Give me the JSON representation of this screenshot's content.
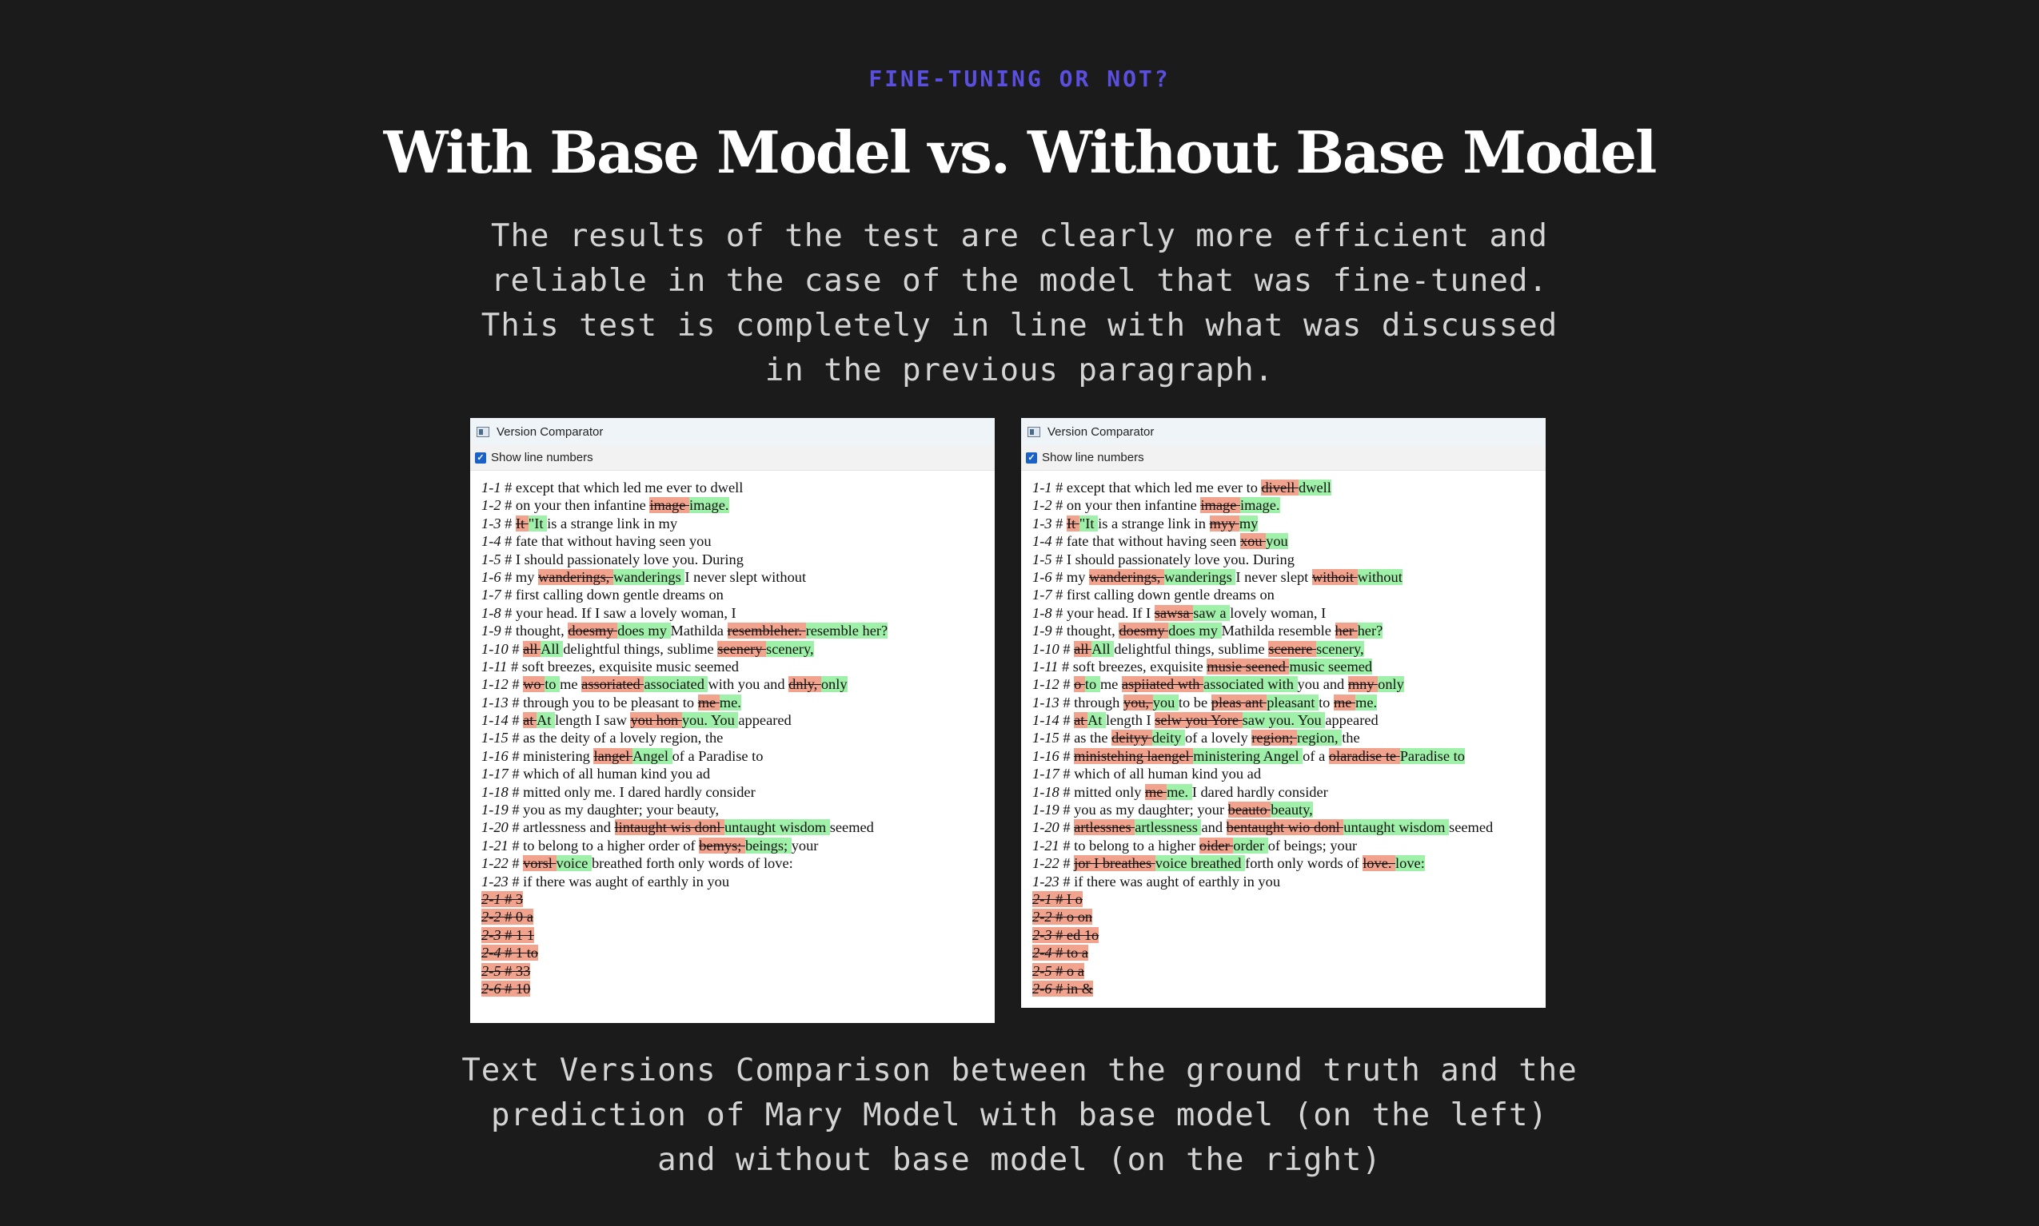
{
  "header": {
    "eyebrow": "FINE-TUNING OR NOT?",
    "title": "With Base Model vs. Without Base Model",
    "intro": "The results of the test are clearly more efficient and reliable in the case of the model that was fine-tuned. This test is completely in line with what was discussed in the previous paragraph."
  },
  "colors": {
    "background": "#1b1b1b",
    "accent": "#5b4fe0",
    "deleted_highlight": "#f2a38d",
    "inserted_highlight": "#9ff0a8"
  },
  "left_window": {
    "title": "Version Comparator",
    "show_line_numbers_label": "Show line numbers",
    "show_line_numbers_checked": true,
    "lines": [
      {
        "n": "1-1",
        "segs": [
          [
            "t",
            "except that which led me ever to dwell"
          ]
        ]
      },
      {
        "n": "1-2",
        "segs": [
          [
            "t",
            "on your then infantine "
          ],
          [
            "d",
            "image "
          ],
          [
            "i",
            "image."
          ]
        ]
      },
      {
        "n": "1-3",
        "segs": [
          [
            "d",
            "It "
          ],
          [
            "i",
            "\"It "
          ],
          [
            "t",
            "is a strange link in my"
          ]
        ]
      },
      {
        "n": "1-4",
        "segs": [
          [
            "t",
            "fate that without having seen you"
          ]
        ]
      },
      {
        "n": "1-5",
        "segs": [
          [
            "t",
            "I should passionately love you. During"
          ]
        ]
      },
      {
        "n": "1-6",
        "segs": [
          [
            "t",
            "my "
          ],
          [
            "d",
            "wanderings, "
          ],
          [
            "i",
            "wanderings "
          ],
          [
            "t",
            "I never slept without"
          ]
        ]
      },
      {
        "n": "1-7",
        "segs": [
          [
            "t",
            "first calling down gentle dreams on"
          ]
        ]
      },
      {
        "n": "1-8",
        "segs": [
          [
            "t",
            "your head. If I saw a lovely woman, I"
          ]
        ]
      },
      {
        "n": "1-9",
        "segs": [
          [
            "t",
            "thought, "
          ],
          [
            "d",
            "doesmy "
          ],
          [
            "i",
            "does my "
          ],
          [
            "t",
            "Mathilda "
          ],
          [
            "d",
            "resembleher. "
          ],
          [
            "i",
            "resemble her?"
          ]
        ]
      },
      {
        "n": "1-10",
        "segs": [
          [
            "d",
            "all "
          ],
          [
            "i",
            "All "
          ],
          [
            "t",
            "delightful things, sublime "
          ],
          [
            "d",
            "seenery "
          ],
          [
            "i",
            "scenery,"
          ]
        ]
      },
      {
        "n": "1-11",
        "segs": [
          [
            "t",
            "soft breezes, exquisite music seemed"
          ]
        ]
      },
      {
        "n": "1-12",
        "segs": [
          [
            "d",
            "wo "
          ],
          [
            "i",
            "to "
          ],
          [
            "t",
            "me "
          ],
          [
            "d",
            "assoriated "
          ],
          [
            "i",
            "associated "
          ],
          [
            "t",
            "with you and "
          ],
          [
            "d",
            "dnly, "
          ],
          [
            "i",
            "only"
          ]
        ]
      },
      {
        "n": "1-13",
        "segs": [
          [
            "t",
            "through you to be pleasant to "
          ],
          [
            "d",
            "me "
          ],
          [
            "i",
            "me."
          ]
        ]
      },
      {
        "n": "1-14",
        "segs": [
          [
            "d",
            "at "
          ],
          [
            "i",
            "At "
          ],
          [
            "t",
            "length I saw "
          ],
          [
            "d",
            "you hon "
          ],
          [
            "i",
            "you. You "
          ],
          [
            "t",
            "appeared"
          ]
        ]
      },
      {
        "n": "1-15",
        "segs": [
          [
            "t",
            "as the deity of a lovely region, the"
          ]
        ]
      },
      {
        "n": "1-16",
        "segs": [
          [
            "t",
            "ministering "
          ],
          [
            "d",
            "langel "
          ],
          [
            "i",
            "Angel "
          ],
          [
            "t",
            "of a Paradise to"
          ]
        ]
      },
      {
        "n": "1-17",
        "segs": [
          [
            "t",
            "which of all human kind you ad"
          ]
        ]
      },
      {
        "n": "1-18",
        "segs": [
          [
            "t",
            "mitted only me. I dared hardly consider"
          ]
        ]
      },
      {
        "n": "1-19",
        "segs": [
          [
            "t",
            "you as my daughter; your beauty,"
          ]
        ]
      },
      {
        "n": "1-20",
        "segs": [
          [
            "t",
            "artlessness and "
          ],
          [
            "d",
            "lintaught wis donl "
          ],
          [
            "i",
            "untaught wisdom "
          ],
          [
            "t",
            "seemed"
          ]
        ]
      },
      {
        "n": "1-21",
        "segs": [
          [
            "t",
            "to belong to a higher order of "
          ],
          [
            "d",
            "bemys; "
          ],
          [
            "i",
            "beings; "
          ],
          [
            "t",
            "your"
          ]
        ]
      },
      {
        "n": "1-22",
        "segs": [
          [
            "d",
            "vorsl "
          ],
          [
            "i",
            "voice "
          ],
          [
            "t",
            "breathed forth only words of love:"
          ]
        ]
      },
      {
        "n": "1-23",
        "segs": [
          [
            "t",
            "if there was aught of earthly in you"
          ]
        ]
      },
      {
        "n": "2-1",
        "del": true,
        "segs": [
          [
            "d",
            "3"
          ]
        ]
      },
      {
        "n": "2-2",
        "del": true,
        "segs": [
          [
            "d",
            "0 a"
          ]
        ]
      },
      {
        "n": "2-3",
        "del": true,
        "segs": [
          [
            "d",
            "1 1"
          ]
        ]
      },
      {
        "n": "2-4",
        "del": true,
        "segs": [
          [
            "d",
            "1 to"
          ]
        ]
      },
      {
        "n": "2-5",
        "del": true,
        "segs": [
          [
            "d",
            "33"
          ]
        ]
      },
      {
        "n": "2-6",
        "del": true,
        "segs": [
          [
            "d",
            "10"
          ]
        ]
      }
    ]
  },
  "right_window": {
    "title": "Version Comparator",
    "show_line_numbers_label": "Show line numbers",
    "show_line_numbers_checked": true,
    "lines": [
      {
        "n": "1-1",
        "segs": [
          [
            "t",
            "except that which led me ever to "
          ],
          [
            "d",
            "divell "
          ],
          [
            "i",
            "dwell"
          ]
        ]
      },
      {
        "n": "1-2",
        "segs": [
          [
            "t",
            "on your then infantine "
          ],
          [
            "d",
            "image "
          ],
          [
            "i",
            "image."
          ]
        ]
      },
      {
        "n": "1-3",
        "segs": [
          [
            "d",
            "It "
          ],
          [
            "i",
            "\"It "
          ],
          [
            "t",
            "is a strange link in "
          ],
          [
            "d",
            "myy "
          ],
          [
            "i",
            "my"
          ]
        ]
      },
      {
        "n": "1-4",
        "segs": [
          [
            "t",
            "fate that without having seen "
          ],
          [
            "d",
            "xou "
          ],
          [
            "i",
            "you"
          ]
        ]
      },
      {
        "n": "1-5",
        "segs": [
          [
            "t",
            "I should passionately love you. During"
          ]
        ]
      },
      {
        "n": "1-6",
        "segs": [
          [
            "t",
            "my "
          ],
          [
            "d",
            "wanderings, "
          ],
          [
            "i",
            "wanderings "
          ],
          [
            "t",
            "I never slept "
          ],
          [
            "d",
            "withoit "
          ],
          [
            "i",
            "without"
          ]
        ]
      },
      {
        "n": "1-7",
        "segs": [
          [
            "t",
            "first calling down gentle dreams on"
          ]
        ]
      },
      {
        "n": "1-8",
        "segs": [
          [
            "t",
            "your head. If I "
          ],
          [
            "d",
            "sawsa "
          ],
          [
            "i",
            "saw a "
          ],
          [
            "t",
            "lovely woman, I"
          ]
        ]
      },
      {
        "n": "1-9",
        "segs": [
          [
            "t",
            "thought, "
          ],
          [
            "d",
            "doesmy "
          ],
          [
            "i",
            "does my "
          ],
          [
            "t",
            "Mathilda resemble "
          ],
          [
            "d",
            "her "
          ],
          [
            "i",
            "her?"
          ]
        ]
      },
      {
        "n": "1-10",
        "segs": [
          [
            "d",
            "all "
          ],
          [
            "i",
            "All "
          ],
          [
            "t",
            "delightful things, sublime "
          ],
          [
            "d",
            "scenere "
          ],
          [
            "i",
            "scenery,"
          ]
        ]
      },
      {
        "n": "1-11",
        "segs": [
          [
            "t",
            "soft breezes, exquisite "
          ],
          [
            "d",
            "musie seened "
          ],
          [
            "i",
            "music seemed"
          ]
        ]
      },
      {
        "n": "1-12",
        "segs": [
          [
            "d",
            "o "
          ],
          [
            "i",
            "to "
          ],
          [
            "t",
            "me "
          ],
          [
            "d",
            "aspiiated wth "
          ],
          [
            "i",
            "associated with "
          ],
          [
            "t",
            "you and "
          ],
          [
            "d",
            "mny "
          ],
          [
            "i",
            "only"
          ]
        ]
      },
      {
        "n": "1-13",
        "segs": [
          [
            "t",
            "through "
          ],
          [
            "d",
            "you, "
          ],
          [
            "i",
            "you "
          ],
          [
            "t",
            "to be "
          ],
          [
            "d",
            "pleas ant "
          ],
          [
            "i",
            "pleasant "
          ],
          [
            "t",
            "to "
          ],
          [
            "d",
            "me "
          ],
          [
            "i",
            "me."
          ]
        ]
      },
      {
        "n": "1-14",
        "segs": [
          [
            "d",
            "at "
          ],
          [
            "i",
            "At "
          ],
          [
            "t",
            "length I "
          ],
          [
            "d",
            "selw you Yore "
          ],
          [
            "i",
            "saw you. You "
          ],
          [
            "t",
            "appeared"
          ]
        ]
      },
      {
        "n": "1-15",
        "segs": [
          [
            "t",
            "as the "
          ],
          [
            "d",
            "deityy "
          ],
          [
            "i",
            "deity "
          ],
          [
            "t",
            "of a lovely "
          ],
          [
            "d",
            "region; "
          ],
          [
            "i",
            "region, "
          ],
          [
            "t",
            "the"
          ]
        ]
      },
      {
        "n": "1-16",
        "segs": [
          [
            "d",
            "ministehing laengel "
          ],
          [
            "i",
            "ministering Angel "
          ],
          [
            "t",
            "of a "
          ],
          [
            "d",
            "olaradise te "
          ],
          [
            "i",
            "Paradise to"
          ]
        ]
      },
      {
        "n": "1-17",
        "segs": [
          [
            "t",
            "which of all human kind you ad"
          ]
        ]
      },
      {
        "n": "1-18",
        "segs": [
          [
            "t",
            "mitted only "
          ],
          [
            "d",
            "me "
          ],
          [
            "i",
            "me. "
          ],
          [
            "t",
            "I dared hardly consider"
          ]
        ]
      },
      {
        "n": "1-19",
        "segs": [
          [
            "t",
            "you as my daughter; your "
          ],
          [
            "d",
            "beauto "
          ],
          [
            "i",
            "beauty,"
          ]
        ]
      },
      {
        "n": "1-20",
        "segs": [
          [
            "d",
            "artlessnes "
          ],
          [
            "i",
            "artlessness "
          ],
          [
            "t",
            "and "
          ],
          [
            "d",
            "bentaught wio donl "
          ],
          [
            "i",
            "untaught wisdom "
          ],
          [
            "t",
            "seemed"
          ]
        ]
      },
      {
        "n": "1-21",
        "segs": [
          [
            "t",
            "to belong to a higher "
          ],
          [
            "d",
            "oider "
          ],
          [
            "i",
            "order "
          ],
          [
            "t",
            "of beings; your"
          ]
        ]
      },
      {
        "n": "1-22",
        "segs": [
          [
            "d",
            "jor I breathes "
          ],
          [
            "i",
            "voice breathed "
          ],
          [
            "t",
            "forth only words of "
          ],
          [
            "d",
            "love. "
          ],
          [
            "i",
            "love:"
          ]
        ]
      },
      {
        "n": "1-23",
        "segs": [
          [
            "t",
            "if there was aught of earthly in you"
          ]
        ]
      },
      {
        "n": "2-1",
        "del": true,
        "segs": [
          [
            "d",
            "I o"
          ]
        ]
      },
      {
        "n": "2-2",
        "del": true,
        "segs": [
          [
            "d",
            "o on"
          ]
        ]
      },
      {
        "n": "2-3",
        "del": true,
        "segs": [
          [
            "d",
            "ed 1o"
          ]
        ]
      },
      {
        "n": "2-4",
        "del": true,
        "segs": [
          [
            "d",
            "to a"
          ]
        ]
      },
      {
        "n": "2-5",
        "del": true,
        "segs": [
          [
            "d",
            "o a"
          ]
        ]
      },
      {
        "n": "2-6",
        "del": true,
        "segs": [
          [
            "d",
            "in &"
          ]
        ]
      }
    ]
  },
  "caption": "Text Versions Comparison between the ground truth and the prediction of Mary Model with base model (on the left) and without base model (on the right)"
}
